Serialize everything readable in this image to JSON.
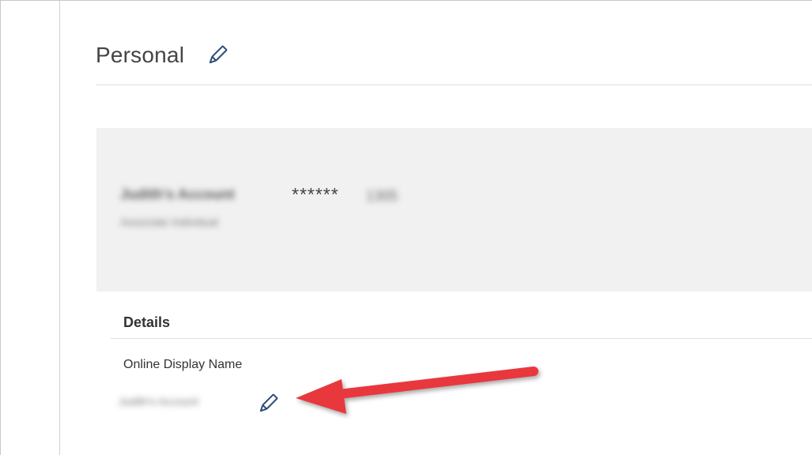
{
  "section": {
    "title": "Personal",
    "edit_icon": "pencil-icon"
  },
  "account": {
    "name": "Judith's Account",
    "mask": "******",
    "suffix": "1305",
    "type": "Associate Individual"
  },
  "details": {
    "heading": "Details",
    "display_name_label": "Online Display Name",
    "display_name_value": "Judith's Account",
    "edit_icon": "pencil-icon"
  },
  "colors": {
    "accent_blue": "#2a4d7a",
    "annotation_red": "#e8373e",
    "card_bg": "#f1f1f1"
  }
}
